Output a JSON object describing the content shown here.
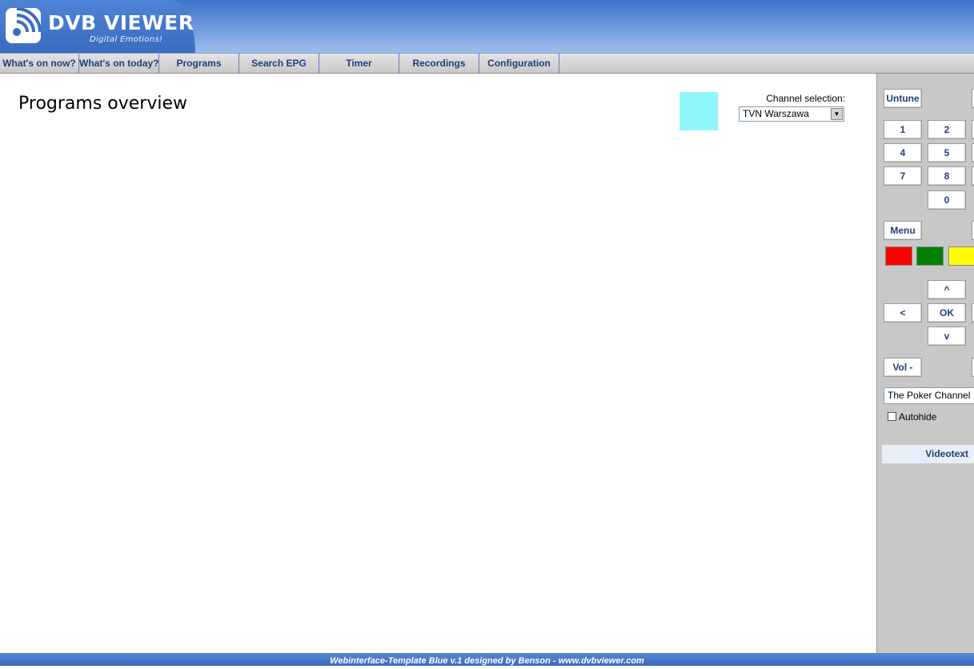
{
  "header": {
    "logo_title": "DVB VIEWER",
    "logo_tagline": "Digital Emotions!"
  },
  "nav": {
    "items": [
      {
        "label": "What's on now?"
      },
      {
        "label": "What's on today?"
      },
      {
        "label": "Programs"
      },
      {
        "label": "Search EPG"
      },
      {
        "label": "Timer"
      },
      {
        "label": "Recordings"
      },
      {
        "label": "Configuration"
      }
    ]
  },
  "main": {
    "title": "Programs overview",
    "channel_selection_label": "Channel selection:",
    "channel_selected": "TVN Warszawa",
    "preview_color": "#8ff7f9"
  },
  "remote": {
    "untune_label": "Untune",
    "digits": [
      "1",
      "2",
      "4",
      "5",
      "7",
      "8",
      "0"
    ],
    "menu_label": "Menu",
    "color_buttons": [
      "#ff0000",
      "#008000",
      "#ffff00"
    ],
    "up_label": "^",
    "left_label": "<",
    "ok_label": "OK",
    "down_label": "v",
    "vol_down_label": "Vol -",
    "osd_channel_selected": "The Poker Channel",
    "autohide_label": "Autohide",
    "videotext_label": "Videotext"
  },
  "footer": {
    "text": "Webinterface-Template Blue v.1 designed by Benson - www.dvbviewer.com"
  }
}
